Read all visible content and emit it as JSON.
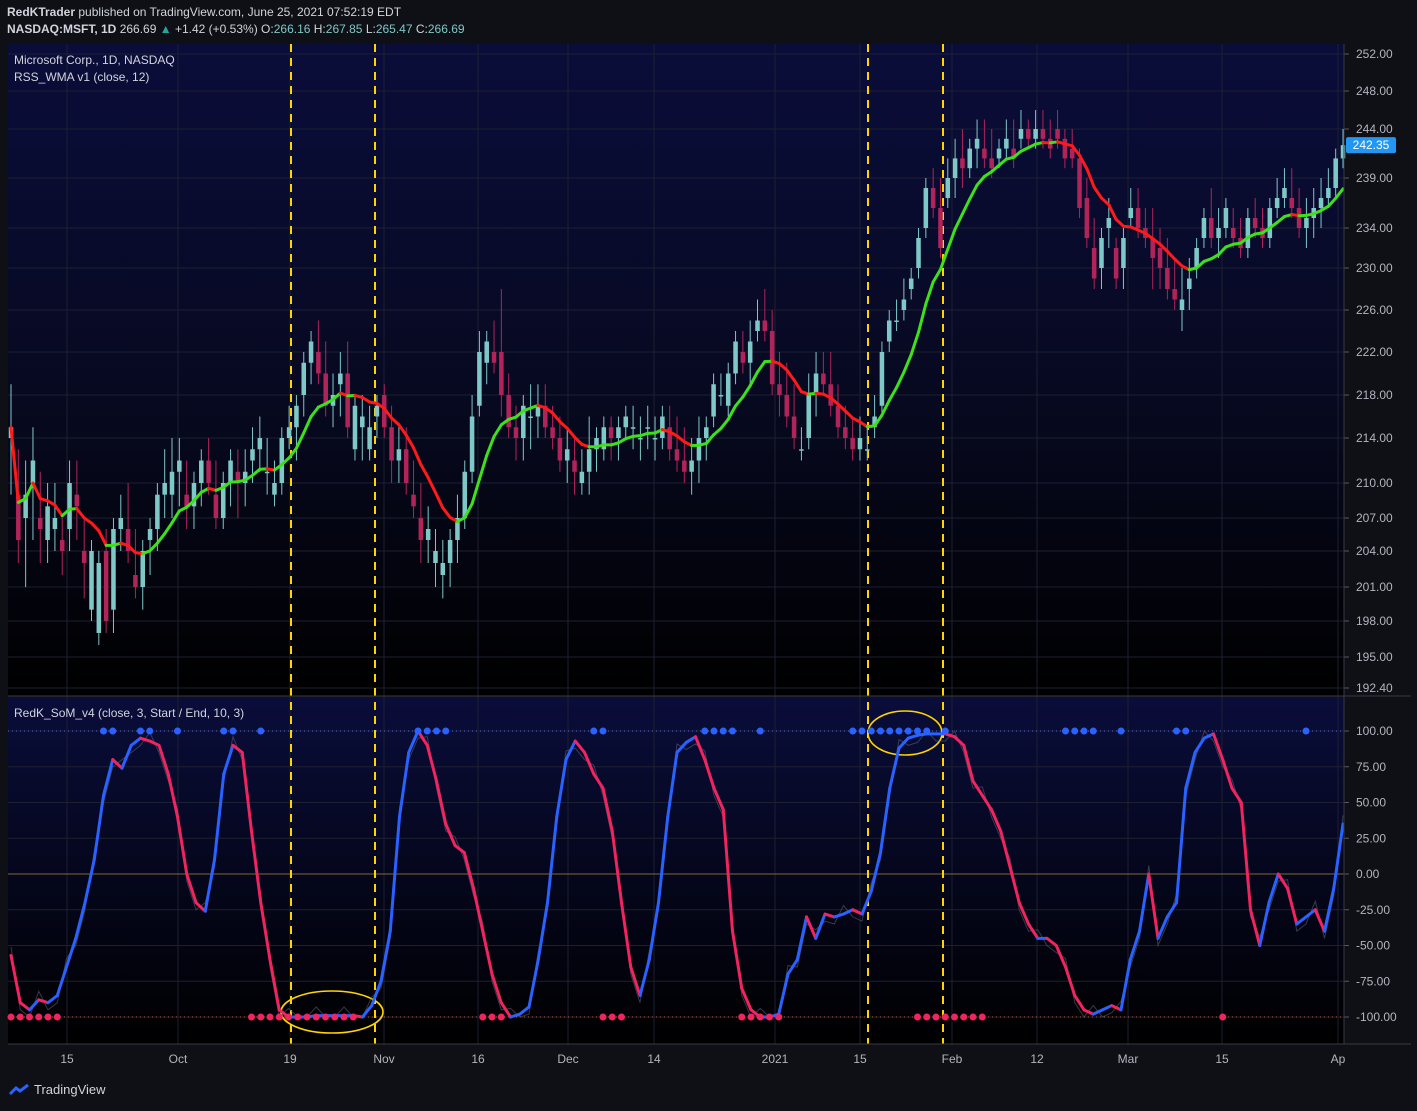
{
  "header": {
    "publisher": "RedKTrader",
    "published_text": "published on TradingView.com, June 25, 2021 07:52:19 EDT",
    "symbol": "NASDAQ:MSFT, 1D",
    "last": "266.69",
    "change": "+1.42 (+0.53%)",
    "o_label": "O:",
    "o_value": "266.16",
    "h_label": "H:",
    "h_value": "267.85",
    "l_label": "L:",
    "l_value": "265.47",
    "c_label": "C:",
    "c_value": "266.69"
  },
  "legend": {
    "title": "Microsoft Corp., 1D, NASDAQ",
    "ma_indicator": "RSS_WMA v1 (close, 12)",
    "osc_indicator": "RedK_SoM_v4 (close, 3, Start / End, 10, 3)"
  },
  "last_price_label": "242.35",
  "footer": {
    "brand": "TradingView"
  },
  "colors": {
    "background": "#0e1016",
    "up_candle": "#7fc8c8",
    "down_candle": "#b0245a",
    "ma_up": "#3ee01a",
    "ma_down": "#ff1a1a",
    "osc_up": "#2962ff",
    "osc_down": "#f0245f",
    "highlight": "#ffd400",
    "price_label": "#2196f3"
  },
  "chart_data": [
    {
      "type": "candlestick",
      "title": "Microsoft Corp., 1D, NASDAQ",
      "y_ticks": [
        "252.00",
        "248.00",
        "244.00",
        "239.00",
        "234.00",
        "230.00",
        "226.00",
        "222.00",
        "218.00",
        "214.00",
        "210.00",
        "207.00",
        "204.00",
        "201.00",
        "198.00",
        "195.00",
        "192.40"
      ],
      "x_ticks": [
        "15",
        "Oct",
        "19",
        "Nov",
        "16",
        "Dec",
        "14",
        "2021",
        "15",
        "Feb",
        "12",
        "Mar",
        "15",
        "Ap"
      ],
      "ylim": [
        192.4,
        252.0
      ],
      "grid": true,
      "ohlc": [
        [
          214,
          219,
          209,
          215
        ],
        [
          209,
          213,
          203,
          205
        ],
        [
          207,
          212,
          201,
          209
        ],
        [
          210,
          215,
          205,
          212
        ],
        [
          207,
          211,
          203,
          206
        ],
        [
          205,
          210,
          203,
          208
        ],
        [
          206,
          210,
          204,
          207
        ],
        [
          205,
          207,
          202,
          204
        ],
        [
          206,
          212,
          204,
          210
        ],
        [
          209,
          212,
          205,
          208
        ],
        [
          204,
          207,
          200,
          203
        ],
        [
          199,
          205,
          198,
          204
        ],
        [
          197,
          204,
          196,
          203
        ],
        [
          204,
          206,
          197,
          198
        ],
        [
          199,
          207,
          197,
          206
        ],
        [
          206,
          209,
          204,
          207
        ],
        [
          206,
          210,
          203,
          204
        ],
        [
          202,
          206,
          200,
          201
        ],
        [
          201,
          205,
          199,
          204
        ],
        [
          205,
          207,
          202,
          206
        ],
        [
          206,
          210,
          204,
          209
        ],
        [
          209,
          213,
          207,
          210
        ],
        [
          209,
          214,
          207,
          211
        ],
        [
          211,
          214,
          208,
          212
        ],
        [
          209,
          212,
          206,
          208
        ],
        [
          208,
          211,
          206,
          210
        ],
        [
          210,
          213,
          208,
          212
        ],
        [
          212,
          214,
          209,
          210
        ],
        [
          209,
          212,
          206,
          207
        ],
        [
          207,
          211,
          206,
          210
        ],
        [
          210,
          213,
          208,
          212
        ],
        [
          211,
          213,
          207,
          210
        ],
        [
          210,
          213,
          208,
          211
        ],
        [
          212,
          215,
          210,
          213
        ],
        [
          213,
          216,
          211,
          214
        ],
        [
          211,
          214,
          209,
          211
        ],
        [
          209,
          212,
          208,
          210
        ],
        [
          210,
          215,
          209,
          214
        ],
        [
          214,
          217,
          213,
          215
        ],
        [
          215,
          218,
          212,
          217
        ],
        [
          218,
          222,
          216,
          221
        ],
        [
          221,
          224,
          219,
          223
        ],
        [
          222,
          225,
          219,
          220
        ],
        [
          220,
          223,
          216,
          217
        ],
        [
          217,
          220,
          215,
          218
        ],
        [
          219,
          222,
          216,
          220
        ],
        [
          220,
          223,
          214,
          215
        ],
        [
          213,
          218,
          212,
          217
        ],
        [
          215,
          218,
          212,
          216
        ],
        [
          213,
          217,
          212,
          215
        ],
        [
          216,
          218,
          214,
          217
        ],
        [
          218,
          219,
          214,
          215
        ],
        [
          215,
          217,
          210,
          212
        ],
        [
          212,
          215,
          210,
          213
        ],
        [
          213,
          215,
          209,
          210
        ],
        [
          209,
          212,
          207,
          208
        ],
        [
          207,
          210,
          203,
          205
        ],
        [
          205,
          208,
          203,
          206
        ],
        [
          203,
          206,
          201,
          204
        ],
        [
          202,
          205,
          200,
          203
        ],
        [
          203,
          206,
          201,
          205
        ],
        [
          205,
          209,
          203,
          207
        ],
        [
          207,
          212,
          206,
          211
        ],
        [
          211,
          218,
          210,
          216
        ],
        [
          217,
          224,
          216,
          222
        ],
        [
          221,
          224,
          219,
          223
        ],
        [
          222,
          225,
          220,
          221
        ],
        [
          222,
          228,
          216,
          218
        ],
        [
          218,
          220,
          214,
          215
        ],
        [
          215,
          217,
          212,
          214
        ],
        [
          214,
          218,
          212,
          217
        ],
        [
          216,
          219,
          213,
          216
        ],
        [
          216,
          219,
          214,
          217
        ],
        [
          217,
          219,
          214,
          215
        ],
        [
          215,
          217,
          213,
          214
        ],
        [
          214,
          216,
          211,
          212
        ],
        [
          212,
          215,
          210,
          213
        ],
        [
          212,
          214,
          209,
          211
        ],
        [
          210,
          213,
          209,
          211
        ],
        [
          211,
          216,
          209,
          213
        ],
        [
          213,
          215,
          211,
          214
        ],
        [
          213,
          216,
          212,
          215
        ],
        [
          215,
          216,
          212,
          214
        ],
        [
          214,
          216,
          212,
          215
        ],
        [
          215,
          217,
          214,
          216
        ],
        [
          215,
          217,
          213,
          215
        ],
        [
          214,
          216,
          212,
          214
        ],
        [
          215,
          217,
          213,
          215
        ],
        [
          214,
          216,
          212,
          214
        ],
        [
          214,
          217,
          213,
          216
        ],
        [
          215,
          217,
          212,
          213
        ],
        [
          213,
          216,
          211,
          212
        ],
        [
          212,
          215,
          210,
          211
        ],
        [
          211,
          214,
          209,
          212
        ],
        [
          212,
          216,
          210,
          214
        ],
        [
          214,
          216,
          212,
          215
        ],
        [
          216,
          220,
          215,
          219
        ],
        [
          218,
          220,
          217,
          218
        ],
        [
          217,
          221,
          216,
          220
        ],
        [
          220,
          224,
          219,
          223
        ],
        [
          222,
          224,
          220,
          221
        ],
        [
          221,
          225,
          219,
          223
        ],
        [
          224,
          227,
          223,
          225
        ],
        [
          225,
          228,
          223,
          224
        ],
        [
          224,
          226,
          218,
          219
        ],
        [
          219,
          222,
          216,
          218
        ],
        [
          218,
          221,
          215,
          216
        ],
        [
          216,
          219,
          213,
          214
        ],
        [
          213,
          215,
          212,
          213
        ],
        [
          214,
          220,
          213,
          218
        ],
        [
          218,
          222,
          216,
          220
        ],
        [
          220,
          222,
          218,
          219
        ],
        [
          219,
          222,
          216,
          217
        ],
        [
          217,
          219,
          214,
          215
        ],
        [
          215,
          217,
          213,
          214
        ],
        [
          214,
          216,
          212,
          213
        ],
        [
          213,
          216,
          212,
          214
        ],
        [
          213,
          215,
          212,
          213
        ],
        [
          215,
          218,
          214,
          216
        ],
        [
          217,
          223,
          216,
          222
        ],
        [
          223,
          226,
          222,
          225
        ],
        [
          225,
          227,
          224,
          225
        ],
        [
          226,
          229,
          225,
          227
        ],
        [
          228,
          230,
          227,
          229
        ],
        [
          230,
          234,
          229,
          233
        ],
        [
          234,
          239,
          233,
          238
        ],
        [
          238,
          240,
          235,
          236
        ],
        [
          236,
          239,
          231,
          232
        ],
        [
          237,
          241,
          236,
          239
        ],
        [
          239,
          243,
          237,
          241
        ],
        [
          241,
          244,
          238,
          240
        ],
        [
          240,
          243,
          239,
          242
        ],
        [
          242,
          245,
          240,
          243
        ],
        [
          242,
          245,
          240,
          241
        ],
        [
          241,
          244,
          239,
          240
        ],
        [
          241,
          243,
          240,
          242
        ],
        [
          242,
          245,
          241,
          243
        ],
        [
          242,
          245,
          240,
          241
        ],
        [
          243,
          246,
          242,
          244
        ],
        [
          244,
          245,
          242,
          243
        ],
        [
          243,
          246,
          242,
          244
        ],
        [
          244,
          246,
          242,
          243
        ],
        [
          243,
          245,
          241,
          242
        ],
        [
          244,
          246,
          242,
          243
        ],
        [
          243,
          244,
          240,
          241
        ],
        [
          242,
          244,
          240,
          241
        ],
        [
          241,
          242,
          235,
          236
        ],
        [
          237,
          239,
          232,
          233
        ],
        [
          232,
          235,
          228,
          229
        ],
        [
          230,
          234,
          228,
          233
        ],
        [
          234,
          237,
          232,
          235
        ],
        [
          232,
          233,
          228,
          229
        ],
        [
          230,
          234,
          228,
          233
        ],
        [
          235,
          238,
          234,
          236
        ],
        [
          236,
          238,
          233,
          234
        ],
        [
          234,
          236,
          232,
          233
        ],
        [
          233,
          236,
          228,
          231
        ],
        [
          232,
          234,
          228,
          230
        ],
        [
          230,
          233,
          227,
          228
        ],
        [
          228,
          231,
          226,
          227
        ],
        [
          226,
          230,
          224,
          227
        ],
        [
          228,
          231,
          226,
          229
        ],
        [
          230,
          233,
          229,
          232
        ],
        [
          233,
          236,
          232,
          235
        ],
        [
          235,
          238,
          232,
          233
        ],
        [
          233,
          236,
          231,
          234
        ],
        [
          234,
          237,
          233,
          236
        ],
        [
          234,
          236,
          232,
          233
        ],
        [
          233,
          235,
          231,
          232
        ],
        [
          232,
          236,
          231,
          235
        ],
        [
          235,
          237,
          233,
          234
        ],
        [
          234,
          236,
          232,
          233
        ],
        [
          233,
          237,
          232,
          236
        ],
        [
          236,
          239,
          235,
          237
        ],
        [
          237,
          240,
          236,
          238
        ],
        [
          237,
          240,
          235,
          236
        ],
        [
          236,
          238,
          233,
          234
        ],
        [
          234,
          237,
          232,
          235
        ],
        [
          235,
          238,
          233,
          236
        ],
        [
          236,
          239,
          234,
          237
        ],
        [
          237,
          240,
          236,
          238
        ],
        [
          238,
          242,
          237,
          241
        ],
        [
          241,
          244,
          240,
          242.35
        ]
      ],
      "ma_label": "RSS_WMA v1 (close, 12)"
    },
    {
      "type": "line",
      "title": "RedK_SoM_v4 (close, 3, Start / End, 10, 3)",
      "y_ticks": [
        "100.00",
        "75.00",
        "50.00",
        "25.00",
        "0.00",
        "-25.00",
        "-50.00",
        "-75.00",
        "-100.00"
      ],
      "ylim": [
        -120,
        115
      ],
      "values": [
        -57,
        -90,
        -95,
        -88,
        -90,
        -85,
        -65,
        -45,
        -20,
        10,
        55,
        80,
        74,
        90,
        95,
        93,
        90,
        70,
        40,
        0,
        -20,
        -26,
        10,
        70,
        90,
        85,
        30,
        -20,
        -60,
        -95,
        -100,
        -100,
        -100,
        -99,
        -99,
        -99,
        -99,
        -99,
        -100,
        -92,
        -75,
        -40,
        40,
        85,
        100,
        90,
        65,
        35,
        20,
        15,
        -10,
        -40,
        -70,
        -90,
        -100,
        -98,
        -93,
        -60,
        -20,
        40,
        80,
        93,
        85,
        70,
        60,
        30,
        -20,
        -65,
        -85,
        -60,
        -20,
        40,
        85,
        92,
        96,
        80,
        60,
        45,
        -40,
        -80,
        -95,
        -100,
        -100,
        -98,
        -70,
        -60,
        -30,
        -45,
        -28,
        -30,
        -28,
        -25,
        -28,
        -12,
        15,
        60,
        88,
        95,
        97,
        98,
        98,
        98,
        96,
        90,
        65,
        55,
        45,
        30,
        5,
        -20,
        -35,
        -45,
        -45,
        -50,
        -65,
        -85,
        -95,
        -98,
        -95,
        -92,
        -95,
        -60,
        -40,
        0,
        -45,
        -30,
        -20,
        60,
        85,
        95,
        98,
        80,
        60,
        50,
        -25,
        -50,
        -20,
        0,
        -10,
        -35,
        -30,
        -25,
        -40,
        -10,
        35
      ],
      "dots_top": [
        10,
        11,
        14,
        15,
        18,
        23,
        24,
        27,
        44,
        45,
        46,
        47,
        63,
        64,
        75,
        76,
        77,
        78,
        81,
        91,
        92,
        93,
        94,
        95,
        96,
        97,
        98,
        99,
        101,
        114,
        115,
        116,
        117,
        120,
        126,
        127,
        140
      ],
      "dots_bottom": [
        0,
        1,
        2,
        3,
        4,
        5,
        26,
        27,
        28,
        29,
        30,
        31,
        32,
        33,
        34,
        35,
        36,
        37,
        51,
        52,
        53,
        64,
        65,
        66,
        79,
        80,
        81,
        82,
        83,
        98,
        99,
        100,
        101,
        102,
        103,
        104,
        105,
        131
      ]
    }
  ]
}
